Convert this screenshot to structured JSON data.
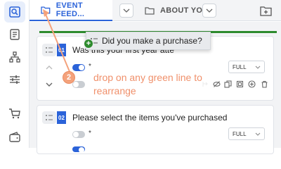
{
  "rail": {
    "items": [
      {
        "name": "form-builder-icon",
        "active": true
      },
      {
        "name": "responses-icon",
        "active": false
      },
      {
        "name": "workflow-icon",
        "active": false
      },
      {
        "name": "settings-sliders-icon",
        "active": false
      },
      {
        "name": "cart-icon",
        "active": false
      },
      {
        "name": "wallet-icon",
        "active": false
      }
    ]
  },
  "tabs": [
    {
      "label": "EVENT FEED...",
      "active": true,
      "icon": "folder-icon"
    },
    {
      "label": "ABOUT YOU",
      "active": false,
      "icon": "folder-icon"
    }
  ],
  "dragging": {
    "label": "Did you make a purchase?",
    "drop_badge": "+"
  },
  "questions": [
    {
      "number": "01",
      "text": "Was this your first year atte",
      "required_mark": "*",
      "size": "FULL",
      "toggle_on": true
    },
    {
      "number": "02",
      "text": "Please select the items you've purchased",
      "required_mark": "*",
      "size": "FULL",
      "toggle_on": false
    }
  ],
  "tutorial": {
    "step": "2",
    "text": "drop on any green line to rearrange"
  },
  "colors": {
    "accent": "#2b63d9",
    "drop_line": "#2e8b2e",
    "tutorial": "#f0906b"
  }
}
